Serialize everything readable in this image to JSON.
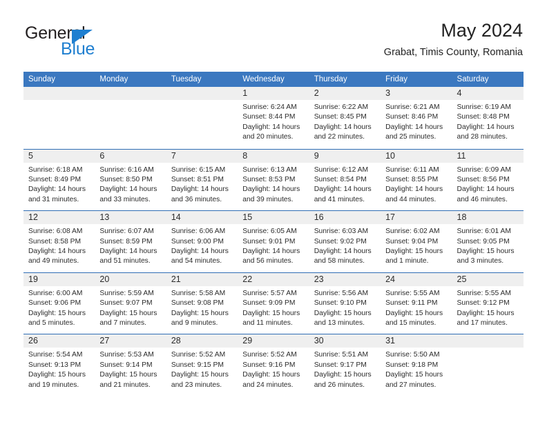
{
  "brand": {
    "name_dark": "General",
    "name_blue": "Blue",
    "triangle_color": "#1f7fd0",
    "text_color": "#231f20"
  },
  "header": {
    "title": "May 2024",
    "subtitle": "Grabat, Timis County, Romania"
  },
  "theme": {
    "header_blue": "#3b78c0",
    "row_divider_blue": "#2f6db5",
    "day_band_gray": "#efefef",
    "text_color": "#2b2b2b"
  },
  "weekdays": [
    "Sunday",
    "Monday",
    "Tuesday",
    "Wednesday",
    "Thursday",
    "Friday",
    "Saturday"
  ],
  "weeks": [
    [
      {
        "day": "",
        "empty": true
      },
      {
        "day": "",
        "empty": true
      },
      {
        "day": "",
        "empty": true
      },
      {
        "day": "1",
        "sunrise": "Sunrise: 6:24 AM",
        "sunset": "Sunset: 8:44 PM",
        "daylight_1": "Daylight: 14 hours",
        "daylight_2": "and 20 minutes."
      },
      {
        "day": "2",
        "sunrise": "Sunrise: 6:22 AM",
        "sunset": "Sunset: 8:45 PM",
        "daylight_1": "Daylight: 14 hours",
        "daylight_2": "and 22 minutes."
      },
      {
        "day": "3",
        "sunrise": "Sunrise: 6:21 AM",
        "sunset": "Sunset: 8:46 PM",
        "daylight_1": "Daylight: 14 hours",
        "daylight_2": "and 25 minutes."
      },
      {
        "day": "4",
        "sunrise": "Sunrise: 6:19 AM",
        "sunset": "Sunset: 8:48 PM",
        "daylight_1": "Daylight: 14 hours",
        "daylight_2": "and 28 minutes."
      }
    ],
    [
      {
        "day": "5",
        "sunrise": "Sunrise: 6:18 AM",
        "sunset": "Sunset: 8:49 PM",
        "daylight_1": "Daylight: 14 hours",
        "daylight_2": "and 31 minutes."
      },
      {
        "day": "6",
        "sunrise": "Sunrise: 6:16 AM",
        "sunset": "Sunset: 8:50 PM",
        "daylight_1": "Daylight: 14 hours",
        "daylight_2": "and 33 minutes."
      },
      {
        "day": "7",
        "sunrise": "Sunrise: 6:15 AM",
        "sunset": "Sunset: 8:51 PM",
        "daylight_1": "Daylight: 14 hours",
        "daylight_2": "and 36 minutes."
      },
      {
        "day": "8",
        "sunrise": "Sunrise: 6:13 AM",
        "sunset": "Sunset: 8:53 PM",
        "daylight_1": "Daylight: 14 hours",
        "daylight_2": "and 39 minutes."
      },
      {
        "day": "9",
        "sunrise": "Sunrise: 6:12 AM",
        "sunset": "Sunset: 8:54 PM",
        "daylight_1": "Daylight: 14 hours",
        "daylight_2": "and 41 minutes."
      },
      {
        "day": "10",
        "sunrise": "Sunrise: 6:11 AM",
        "sunset": "Sunset: 8:55 PM",
        "daylight_1": "Daylight: 14 hours",
        "daylight_2": "and 44 minutes."
      },
      {
        "day": "11",
        "sunrise": "Sunrise: 6:09 AM",
        "sunset": "Sunset: 8:56 PM",
        "daylight_1": "Daylight: 14 hours",
        "daylight_2": "and 46 minutes."
      }
    ],
    [
      {
        "day": "12",
        "sunrise": "Sunrise: 6:08 AM",
        "sunset": "Sunset: 8:58 PM",
        "daylight_1": "Daylight: 14 hours",
        "daylight_2": "and 49 minutes."
      },
      {
        "day": "13",
        "sunrise": "Sunrise: 6:07 AM",
        "sunset": "Sunset: 8:59 PM",
        "daylight_1": "Daylight: 14 hours",
        "daylight_2": "and 51 minutes."
      },
      {
        "day": "14",
        "sunrise": "Sunrise: 6:06 AM",
        "sunset": "Sunset: 9:00 PM",
        "daylight_1": "Daylight: 14 hours",
        "daylight_2": "and 54 minutes."
      },
      {
        "day": "15",
        "sunrise": "Sunrise: 6:05 AM",
        "sunset": "Sunset: 9:01 PM",
        "daylight_1": "Daylight: 14 hours",
        "daylight_2": "and 56 minutes."
      },
      {
        "day": "16",
        "sunrise": "Sunrise: 6:03 AM",
        "sunset": "Sunset: 9:02 PM",
        "daylight_1": "Daylight: 14 hours",
        "daylight_2": "and 58 minutes."
      },
      {
        "day": "17",
        "sunrise": "Sunrise: 6:02 AM",
        "sunset": "Sunset: 9:04 PM",
        "daylight_1": "Daylight: 15 hours",
        "daylight_2": "and 1 minute."
      },
      {
        "day": "18",
        "sunrise": "Sunrise: 6:01 AM",
        "sunset": "Sunset: 9:05 PM",
        "daylight_1": "Daylight: 15 hours",
        "daylight_2": "and 3 minutes."
      }
    ],
    [
      {
        "day": "19",
        "sunrise": "Sunrise: 6:00 AM",
        "sunset": "Sunset: 9:06 PM",
        "daylight_1": "Daylight: 15 hours",
        "daylight_2": "and 5 minutes."
      },
      {
        "day": "20",
        "sunrise": "Sunrise: 5:59 AM",
        "sunset": "Sunset: 9:07 PM",
        "daylight_1": "Daylight: 15 hours",
        "daylight_2": "and 7 minutes."
      },
      {
        "day": "21",
        "sunrise": "Sunrise: 5:58 AM",
        "sunset": "Sunset: 9:08 PM",
        "daylight_1": "Daylight: 15 hours",
        "daylight_2": "and 9 minutes."
      },
      {
        "day": "22",
        "sunrise": "Sunrise: 5:57 AM",
        "sunset": "Sunset: 9:09 PM",
        "daylight_1": "Daylight: 15 hours",
        "daylight_2": "and 11 minutes."
      },
      {
        "day": "23",
        "sunrise": "Sunrise: 5:56 AM",
        "sunset": "Sunset: 9:10 PM",
        "daylight_1": "Daylight: 15 hours",
        "daylight_2": "and 13 minutes."
      },
      {
        "day": "24",
        "sunrise": "Sunrise: 5:55 AM",
        "sunset": "Sunset: 9:11 PM",
        "daylight_1": "Daylight: 15 hours",
        "daylight_2": "and 15 minutes."
      },
      {
        "day": "25",
        "sunrise": "Sunrise: 5:55 AM",
        "sunset": "Sunset: 9:12 PM",
        "daylight_1": "Daylight: 15 hours",
        "daylight_2": "and 17 minutes."
      }
    ],
    [
      {
        "day": "26",
        "sunrise": "Sunrise: 5:54 AM",
        "sunset": "Sunset: 9:13 PM",
        "daylight_1": "Daylight: 15 hours",
        "daylight_2": "and 19 minutes."
      },
      {
        "day": "27",
        "sunrise": "Sunrise: 5:53 AM",
        "sunset": "Sunset: 9:14 PM",
        "daylight_1": "Daylight: 15 hours",
        "daylight_2": "and 21 minutes."
      },
      {
        "day": "28",
        "sunrise": "Sunrise: 5:52 AM",
        "sunset": "Sunset: 9:15 PM",
        "daylight_1": "Daylight: 15 hours",
        "daylight_2": "and 23 minutes."
      },
      {
        "day": "29",
        "sunrise": "Sunrise: 5:52 AM",
        "sunset": "Sunset: 9:16 PM",
        "daylight_1": "Daylight: 15 hours",
        "daylight_2": "and 24 minutes."
      },
      {
        "day": "30",
        "sunrise": "Sunrise: 5:51 AM",
        "sunset": "Sunset: 9:17 PM",
        "daylight_1": "Daylight: 15 hours",
        "daylight_2": "and 26 minutes."
      },
      {
        "day": "31",
        "sunrise": "Sunrise: 5:50 AM",
        "sunset": "Sunset: 9:18 PM",
        "daylight_1": "Daylight: 15 hours",
        "daylight_2": "and 27 minutes."
      },
      {
        "day": "",
        "empty": true
      }
    ]
  ]
}
